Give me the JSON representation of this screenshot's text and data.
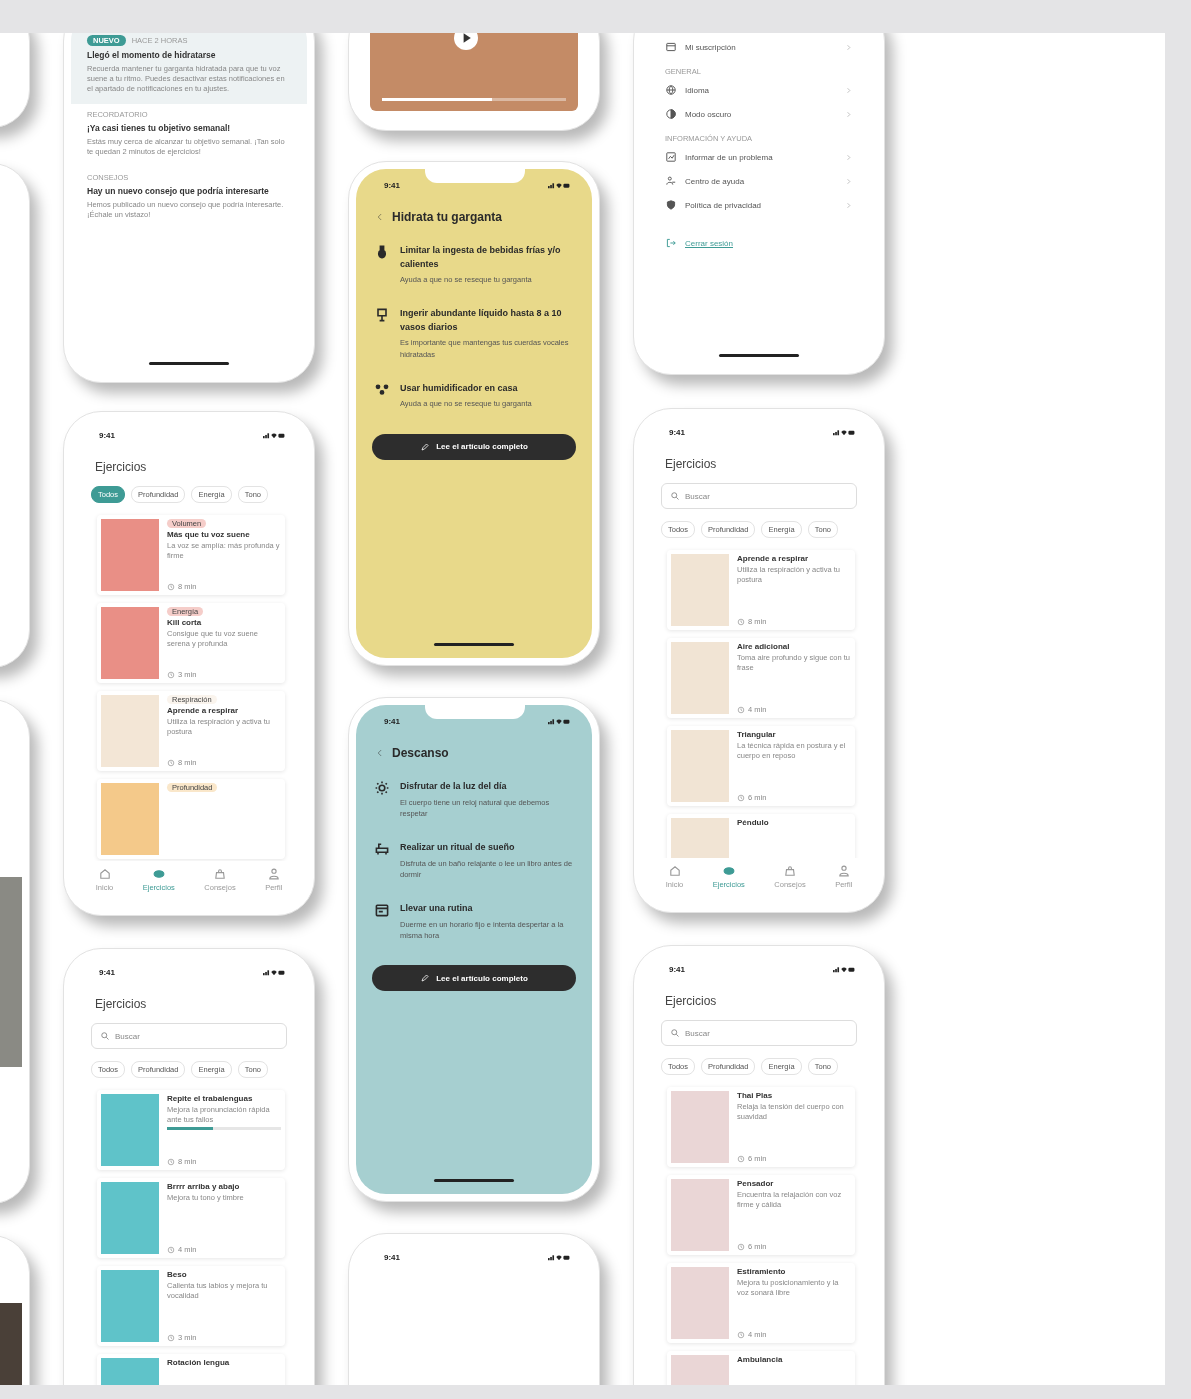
{
  "columns": [
    {
      "screens": [
        {
          "kind": "edge"
        },
        {
          "kind": "edge"
        },
        {
          "kind": "edge",
          "photo": true
        },
        {
          "kind": "edge",
          "photo": true
        }
      ]
    },
    {
      "screens": [
        {
          "kind": "notifications",
          "items": [
            {
              "tag": "NUEVO",
              "meta": "HACE 2 HORAS",
              "title": "Llegó el momento de hidratarse",
              "body": "Recuerda mantener tu garganta hidratada para que tu voz suene a tu ritmo. Puedes desactivar estas notificaciones en el apartado de notificaciones en tu ajustes.",
              "highlighted": true
            },
            {
              "meta": "RECORDATORIO",
              "title": "¡Ya casi tienes tu objetivo semanal!",
              "body": "Estás muy cerca de alcanzar tu objetivo semanal. ¡Tan solo te quedan 2 minutos de ejercicios!",
              "highlighted": false
            },
            {
              "meta": "CONSEJOS",
              "title": "Hay un nuevo consejo que podría interesarte",
              "body": "Hemos publicado un nuevo consejo que podría interesarte. ¡Échale un vistazo!",
              "highlighted": false
            }
          ]
        },
        {
          "kind": "exercises",
          "time": "9:41",
          "title": "Ejercicios",
          "chips": [
            {
              "label": "Todos",
              "selected": true
            },
            {
              "label": "Profundidad",
              "selected": false
            },
            {
              "label": "Energía",
              "selected": false
            },
            {
              "label": "Tono",
              "selected": false
            }
          ],
          "cards": [
            {
              "tag": "Volumen",
              "color": "#e98f86",
              "title": "Más que tu voz suene",
              "desc": "La voz se amplía: más profunda y firme",
              "duration": "8 min"
            },
            {
              "tag": "Energía",
              "color": "#e98f86",
              "title": "Kill corta",
              "desc": "Consigue que tu voz suene serena y profunda",
              "duration": "3 min"
            },
            {
              "tag": "Respiración",
              "color": "#f3e6d6",
              "title": "Aprende a respirar",
              "desc": "Utiliza la respiración y activa tu postura",
              "duration": "8 min"
            },
            {
              "tag": "Profundidad",
              "color": "#f4c98a"
            }
          ],
          "tabs": [
            {
              "label": "Inicio",
              "selected": false
            },
            {
              "label": "Ejercicios",
              "selected": true
            },
            {
              "label": "Consejos",
              "selected": false
            },
            {
              "label": "Perfil",
              "selected": false
            }
          ]
        },
        {
          "kind": "exercises",
          "time": "9:41",
          "title": "Ejercicios",
          "search": {
            "placeholder": "Buscar"
          },
          "chips": [
            {
              "label": "Todos",
              "selected": false
            },
            {
              "label": "Profundidad",
              "selected": false
            },
            {
              "label": "Energía",
              "selected": false
            },
            {
              "label": "Tono",
              "selected": false
            }
          ],
          "cards": [
            {
              "color": "#5fc3c9",
              "title": "Repite el trabalenguas",
              "desc": "Mejora la pronunciación rápida ante tus fallos",
              "duration": "8 min",
              "level": 0.4
            },
            {
              "color": "#5fc3c9",
              "title": "Brrrr arriba y abajo",
              "desc": "Mejora tu tono y timbre",
              "duration": "4 min"
            },
            {
              "color": "#5fc3c9",
              "title": "Beso",
              "desc": "Calienta tus labios y mejora tu vocalidad",
              "duration": "3 min"
            },
            {
              "color": "#5fc3c9",
              "title": "Rotación lengua"
            }
          ]
        }
      ]
    },
    {
      "screens": [
        {
          "kind": "video",
          "level": 0.6
        },
        {
          "kind": "tips",
          "time": "9:41",
          "color": "#e8d98a",
          "title": "Hidrata tu garganta",
          "items": [
            {
              "title": "Limitar la ingesta de bebidas frías y/o calientes",
              "desc": "Ayuda a que no se reseque tu garganta"
            },
            {
              "title": "Ingerir abundante líquido hasta 8 a 10 vasos diarios",
              "desc": "Es importante que mantengas tus cuerdas vocales hidratadas"
            },
            {
              "title": "Usar humidificador en casa",
              "desc": "Ayuda a que no se reseque tu garganta"
            }
          ],
          "button": "Lee el artículo completo"
        },
        {
          "kind": "tips",
          "time": "9:41",
          "color": "#a6cfd0",
          "title": "Descanso",
          "items": [
            {
              "title": "Disfrutar de la luz del día",
              "desc": "El cuerpo tiene un reloj natural que debemos respetar"
            },
            {
              "title": "Realizar un ritual de sueño",
              "desc": "Disfruta de un baño relajante o lee un libro antes de dormir"
            },
            {
              "title": "Llevar una rutina",
              "desc": "Duerme en un horario fijo e intenta despertar a la misma hora"
            }
          ],
          "button": "Lee el artículo completo"
        },
        {
          "kind": "blank",
          "time": "9:41"
        }
      ]
    },
    {
      "screens": [
        {
          "kind": "settings",
          "sections": [
            {
              "rows": [
                {
                  "label": "Mi suscripción"
                }
              ]
            },
            {
              "heading": "GENERAL",
              "rows": [
                {
                  "label": "Idioma"
                },
                {
                  "label": "Modo oscuro"
                }
              ]
            },
            {
              "heading": "INFORMACIÓN Y AYUDA",
              "rows": [
                {
                  "label": "Informar de un problema"
                },
                {
                  "label": "Centro de ayuda"
                },
                {
                  "label": "Política de privacidad"
                }
              ]
            }
          ],
          "logout": "Cerrar sesión"
        },
        {
          "kind": "exercises",
          "time": "9:41",
          "title": "Ejercicios",
          "search": {
            "placeholder": "Buscar"
          },
          "chips": [
            {
              "label": "Todos",
              "selected": false
            },
            {
              "label": "Profundidad",
              "selected": false
            },
            {
              "label": "Energía",
              "selected": false
            },
            {
              "label": "Tono",
              "selected": false
            }
          ],
          "cards": [
            {
              "color": "#f1e4d4",
              "title": "Aprende a respirar",
              "desc": "Utiliza la respiración y activa tu postura",
              "duration": "8 min"
            },
            {
              "color": "#f1e4d4",
              "title": "Aire adicional",
              "desc": "Toma aire profundo y sigue con tu frase",
              "duration": "4 min"
            },
            {
              "color": "#f1e4d4",
              "title": "Triangular",
              "desc": "La técnica rápida en postura y el cuerpo en reposo",
              "duration": "6 min"
            },
            {
              "color": "#f1e4d4",
              "title": "Péndulo"
            }
          ],
          "tabs": [
            {
              "label": "Inicio",
              "selected": false
            },
            {
              "label": "Ejercicios",
              "selected": true
            },
            {
              "label": "Consejos",
              "selected": false
            },
            {
              "label": "Perfil",
              "selected": false
            }
          ]
        },
        {
          "kind": "exercises",
          "time": "9:41",
          "title": "Ejercicios",
          "search": {
            "placeholder": "Buscar"
          },
          "chips": [
            {
              "label": "Todos",
              "selected": false
            },
            {
              "label": "Profundidad",
              "selected": false
            },
            {
              "label": "Energía",
              "selected": false
            },
            {
              "label": "Tono",
              "selected": false
            }
          ],
          "cards": [
            {
              "color": "#ead6d6",
              "title": "Thai Plas",
              "desc": "Relaja la tensión del cuerpo con suavidad",
              "duration": "6 min"
            },
            {
              "color": "#ead6d6",
              "title": "Pensador",
              "desc": "Encuentra la relajación con voz firme y cálida",
              "duration": "6 min"
            },
            {
              "color": "#ead6d6",
              "title": "Estiramiento",
              "desc": "Mejora tu posicionamiento y la voz sonará libre",
              "duration": "4 min"
            },
            {
              "color": "#ead6d6",
              "title": "Ambulancia"
            }
          ]
        }
      ]
    }
  ]
}
